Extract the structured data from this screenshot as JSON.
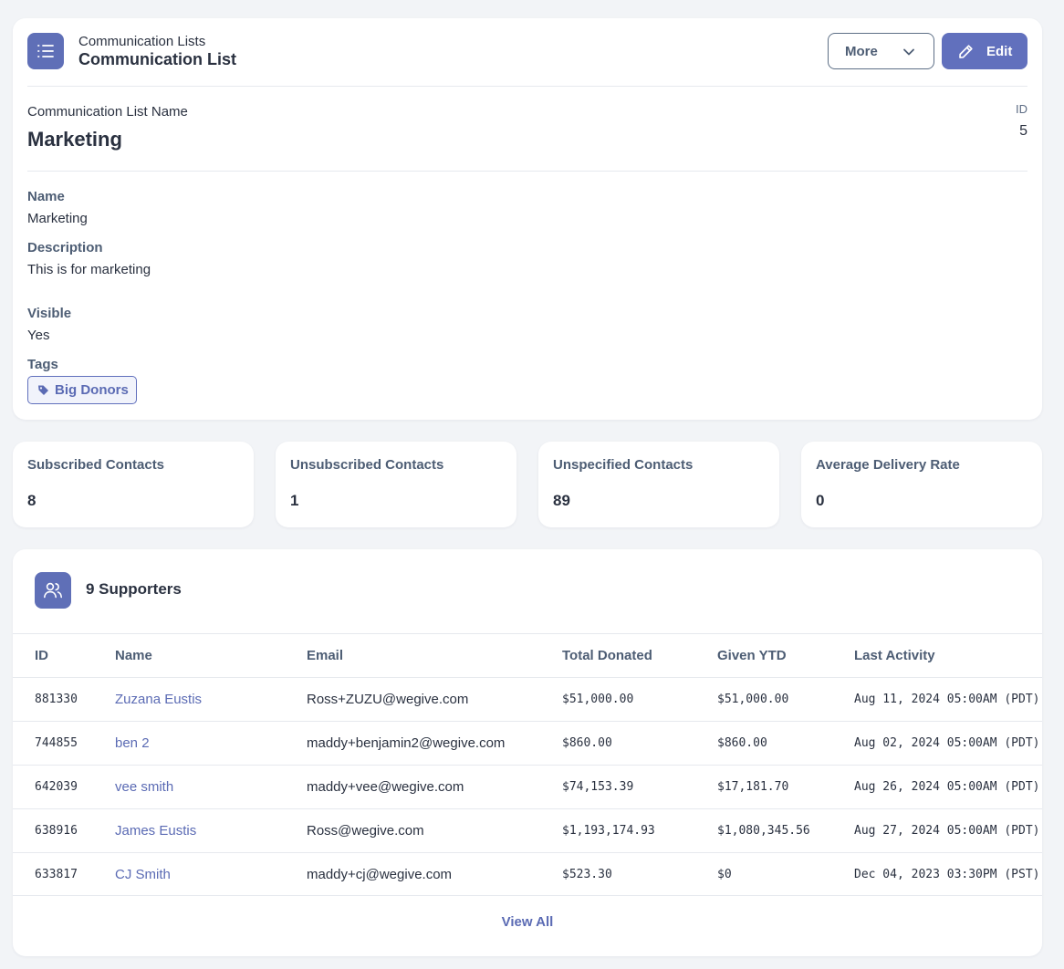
{
  "header": {
    "breadcrumb": "Communication Lists",
    "title": "Communication List",
    "more_label": "More",
    "edit_label": "Edit"
  },
  "record": {
    "name_caption": "Communication List Name",
    "name_value": "Marketing",
    "id_caption": "ID",
    "id_value": "5"
  },
  "fields": {
    "name_label": "Name",
    "name_value": "Marketing",
    "description_label": "Description",
    "description_value": "This is for marketing",
    "visible_label": "Visible",
    "visible_value": "Yes",
    "tags_label": "Tags",
    "tags": [
      "Big Donors"
    ]
  },
  "stats": [
    {
      "title": "Subscribed Contacts",
      "value": "8"
    },
    {
      "title": "Unsubscribed Contacts",
      "value": "1"
    },
    {
      "title": "Unspecified Contacts",
      "value": "89"
    },
    {
      "title": "Average Delivery Rate",
      "value": "0"
    }
  ],
  "supporters": {
    "title": "9 Supporters",
    "columns": [
      "ID",
      "Name",
      "Email",
      "Total Donated",
      "Given YTD",
      "Last Activity"
    ],
    "rows": [
      {
        "id": "881330",
        "name": "Zuzana Eustis",
        "email": "Ross+ZUZU@wegive.com",
        "total": "$51,000.00",
        "ytd": "$51,000.00",
        "activity": "Aug 11, 2024 05:00AM (PDT)"
      },
      {
        "id": "744855",
        "name": "ben 2",
        "email": "maddy+benjamin2@wegive.com",
        "total": "$860.00",
        "ytd": "$860.00",
        "activity": "Aug 02, 2024 05:00AM (PDT)"
      },
      {
        "id": "642039",
        "name": "vee smith",
        "email": "maddy+vee@wegive.com",
        "total": "$74,153.39",
        "ytd": "$17,181.70",
        "activity": "Aug 26, 2024 05:00AM (PDT)"
      },
      {
        "id": "638916",
        "name": "James Eustis",
        "email": "Ross@wegive.com",
        "total": "$1,193,174.93",
        "ytd": "$1,080,345.56",
        "activity": "Aug 27, 2024 05:00AM (PDT)"
      },
      {
        "id": "633817",
        "name": "CJ Smith",
        "email": "maddy+cj@wegive.com",
        "total": "$523.30",
        "ytd": "$0",
        "activity": "Dec 04, 2023 03:30PM (PST)"
      }
    ],
    "view_all_label": "View All"
  },
  "colors": {
    "accent": "#6170bd",
    "link": "#5b6bb4",
    "label": "#4d5d74",
    "background": "#f2f4f7"
  },
  "icons": {
    "header": "list-icon",
    "more": "chevron-down-icon",
    "edit": "pencil-icon",
    "tag": "tag-icon",
    "supporters": "users-icon"
  }
}
